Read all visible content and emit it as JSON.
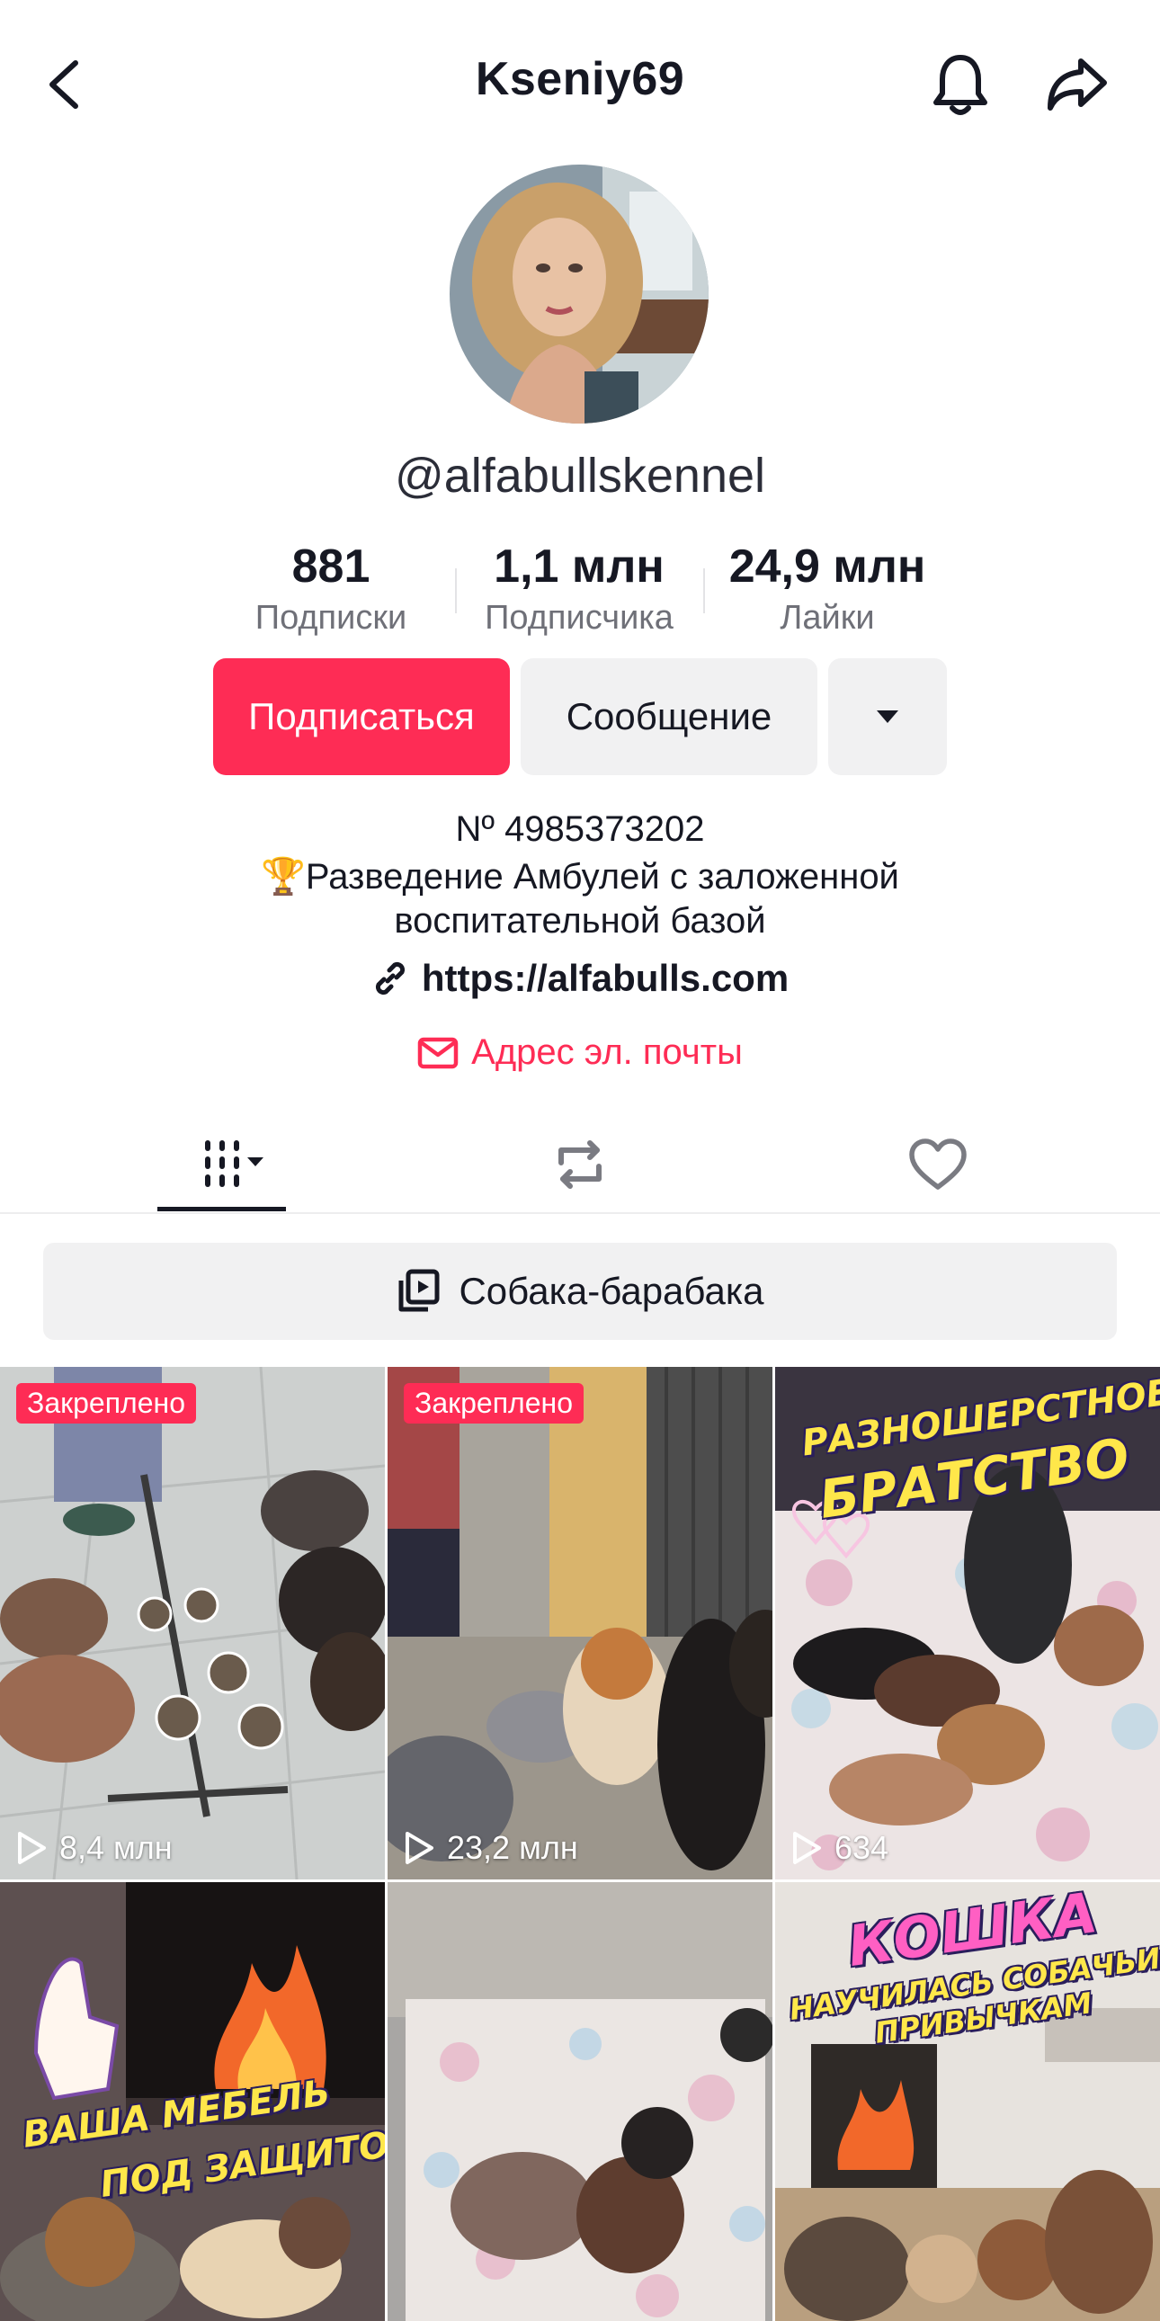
{
  "header": {
    "username": "Kseniy69"
  },
  "profile": {
    "handle": "@alfabullskennel",
    "stats": [
      {
        "value": "881",
        "label": "Подписки"
      },
      {
        "value": "1,1 млн",
        "label": "Подписчика"
      },
      {
        "value": "24,9 млн",
        "label": "Лайки"
      }
    ],
    "follow_label": "Подписаться",
    "message_label": "Сообщение",
    "bio_line1": "Nº 4985373202",
    "bio_line2": "🏆Разведение Амбулей с заложенной",
    "bio_line3": "воспитательной базой",
    "link": "https://alfabulls.com",
    "email_label": "Адрес эл. почты"
  },
  "playlist": {
    "label": "Собака-барабака"
  },
  "videos": [
    {
      "pinned": "Закреплено",
      "views": "8,4 млн"
    },
    {
      "pinned": "Закреплено",
      "views": "23,2 млн"
    },
    {
      "views": "634",
      "overlay1": "РАЗНОШЕРСТНОЕ",
      "overlay2": "БРАТСТВО"
    },
    {
      "overlay1": "ВАША МЕБЕЛЬ",
      "overlay2": "ПОД ЗАЩИТОЙ!"
    },
    {},
    {
      "overlay1": "КОШКА",
      "overlay2": "НАУЧИЛАСЬ СОБАЧЬИМ",
      "overlay3": "ПРИВЫЧКАМ"
    }
  ],
  "colors": {
    "accent": "#fe2c55",
    "secondary_button": "#f1f1f2",
    "text": "#161823"
  },
  "icons": [
    "back-arrow-icon",
    "bell-icon",
    "share-icon",
    "dropdown-caret-icon",
    "link-icon",
    "mail-icon",
    "videos-grid-icon",
    "repost-icon",
    "heart-icon",
    "playlist-icon",
    "play-icon"
  ]
}
